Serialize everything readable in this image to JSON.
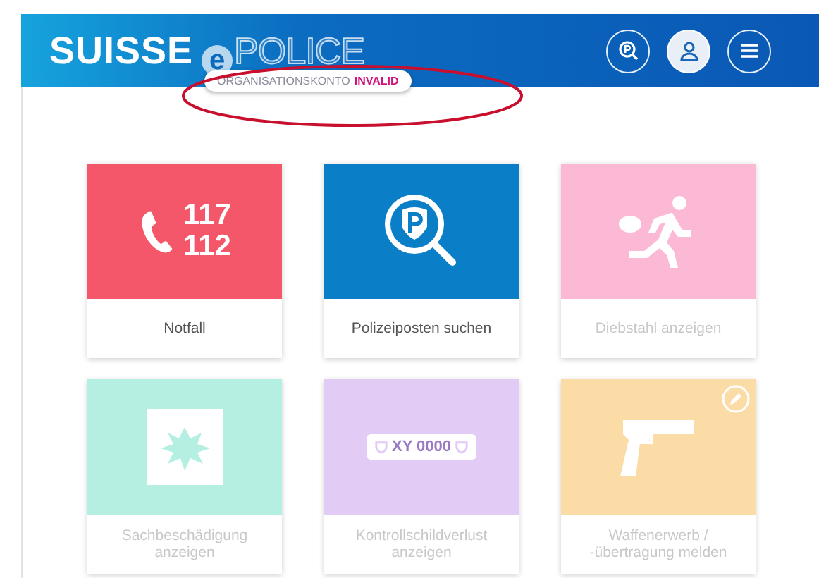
{
  "header": {
    "brand": "SUISSE",
    "logo_mark": "e",
    "logo_word": "POLICE",
    "badge": {
      "label": "ORGANISATIONSKONTO",
      "status": "INVALID"
    },
    "buttons": [
      {
        "kind": "station-search",
        "selected": false
      },
      {
        "kind": "user",
        "selected": true
      },
      {
        "kind": "menu",
        "selected": false
      }
    ]
  },
  "annotation": {
    "kind": "ellipse"
  },
  "tiles": [
    {
      "label": "Notfall",
      "kind": "emergency",
      "color": "#f4566a",
      "disabled": false,
      "numbers": [
        "117",
        "112"
      ]
    },
    {
      "label": "Polizeiposten suchen",
      "kind": "station",
      "color": "#0a7fc7",
      "disabled": false
    },
    {
      "label": "Diebstahl anzeigen",
      "kind": "theft",
      "color": "#fbb9d6",
      "disabled": true
    },
    {
      "label": "Sachbeschädigung anzeigen",
      "kind": "damage",
      "color": "#b5efe1",
      "disabled": true
    },
    {
      "label": "Kontrollschildverlust anzeigen",
      "kind": "plate",
      "color": "#e2cbf5",
      "disabled": true,
      "plate": "XY 0000"
    },
    {
      "label": "Waffenerwerb / -übertragung melden",
      "kind": "weapon",
      "color": "#fcdca6",
      "disabled": true,
      "editable": true
    }
  ]
}
